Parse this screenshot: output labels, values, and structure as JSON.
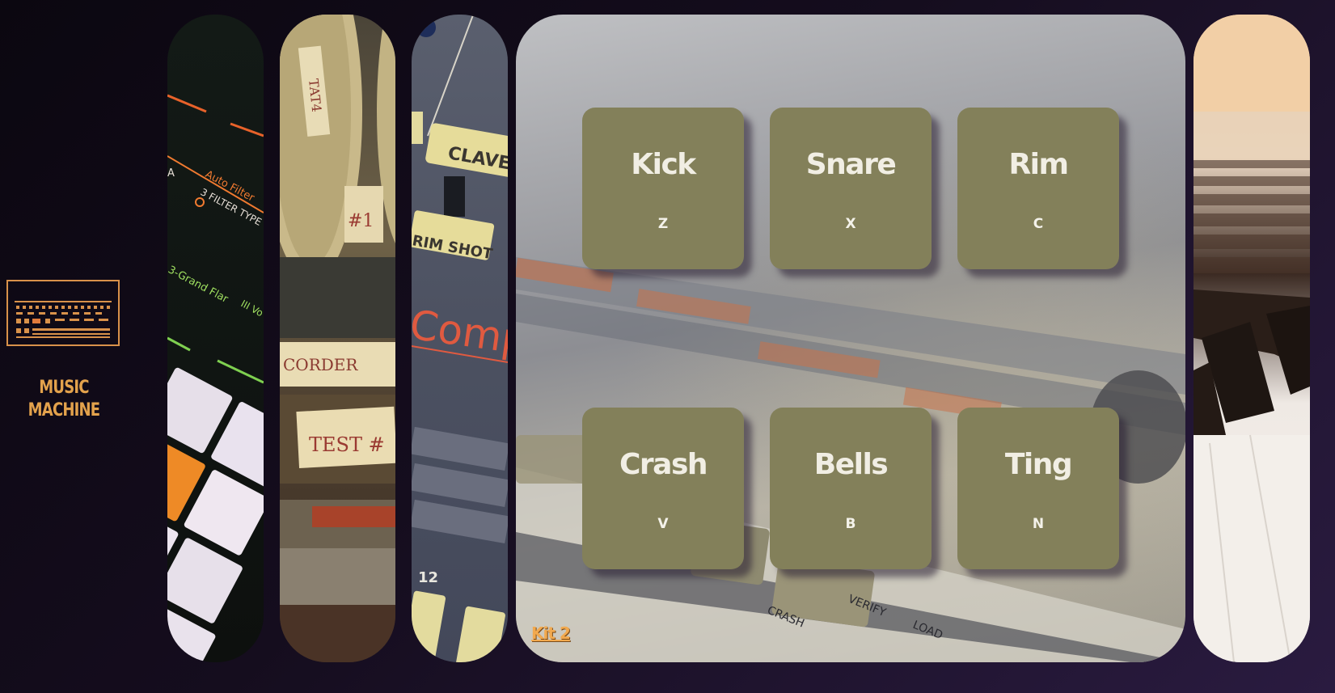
{
  "brand": {
    "title_line1": "MUSIC",
    "title_line2": "MACHINE",
    "logo_icon": "drum-machine-icon",
    "accent_color": "#e3a24c"
  },
  "pads": [
    {
      "name": "Kick",
      "key": "Z"
    },
    {
      "name": "Snare",
      "key": "X"
    },
    {
      "name": "Rim",
      "key": "C"
    },
    {
      "name": "Crash",
      "key": "V"
    },
    {
      "name": "Bells",
      "key": "B"
    },
    {
      "name": "Ting",
      "key": "N"
    }
  ],
  "pad_color": "#83805a",
  "kit": {
    "label": "Kit 2"
  },
  "panels": [
    {
      "image": "launchpad-controller-photo",
      "labels": [
        "Auto Filter",
        "3 FILTER TYPE",
        "3-Grand Flar",
        "III Vo",
        "A"
      ]
    },
    {
      "image": "reel-to-reel-tape-recorder-photo",
      "labels": [
        "TAT4",
        "#1",
        "CORDER",
        "TEST #"
      ]
    },
    {
      "image": "drum-machine-closeup-photo",
      "labels": [
        "CLAVES",
        "RIM SHOT",
        "Comp",
        "12"
      ]
    },
    {
      "image": "drum-machine-background-photo",
      "labels": [
        "CRASH",
        "VERIFY",
        "LOAD"
      ]
    },
    {
      "image": "piano-keys-photo",
      "labels": []
    }
  ]
}
